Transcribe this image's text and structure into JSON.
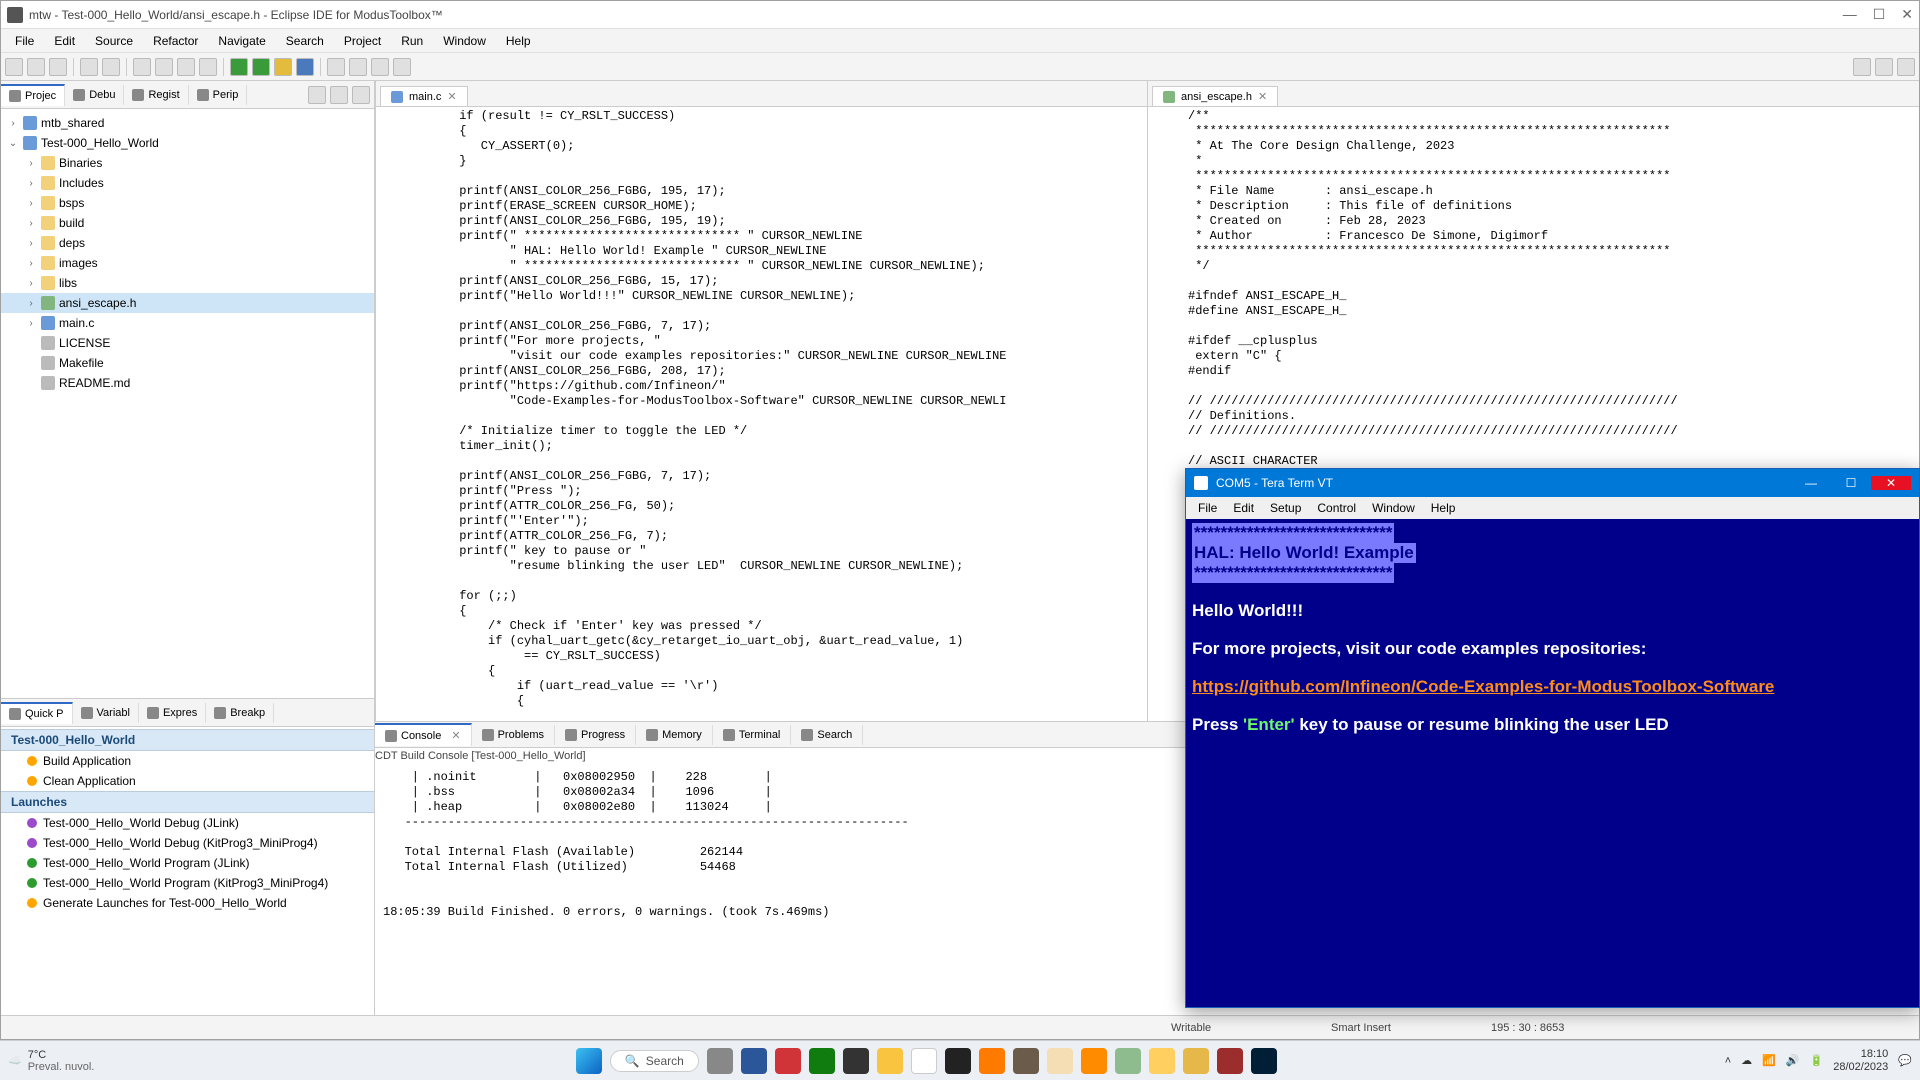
{
  "eclipse": {
    "title": "mtw - Test-000_Hello_World/ansi_escape.h - Eclipse IDE for ModusToolbox™",
    "menu": [
      "File",
      "Edit",
      "Source",
      "Refactor",
      "Navigate",
      "Search",
      "Project",
      "Run",
      "Window",
      "Help"
    ],
    "left_views": [
      "Projec",
      "Debu",
      "Regist",
      "Perip"
    ],
    "tree": {
      "root1": "mtb_shared",
      "root2": "Test-000_Hello_World",
      "children": [
        "Binaries",
        "Includes",
        "bsps",
        "build",
        "deps",
        "images",
        "libs"
      ],
      "file1": "ansi_escape.h",
      "file2": "main.c",
      "file3": "LICENSE",
      "file4": "Makefile",
      "file5": "README.md"
    },
    "quick_tabs": [
      "Quick P",
      "Variabl",
      "Expres",
      "Breakp"
    ],
    "quick": {
      "section0": "Test-000_Hello_World",
      "build": "Build Application",
      "clean": "Clean Application",
      "launches_label": "Launches",
      "l1": "Test-000_Hello_World Debug (JLink)",
      "l2": "Test-000_Hello_World Debug (KitProg3_MiniProg4)",
      "l3": "Test-000_Hello_World Program (JLink)",
      "l4": "Test-000_Hello_World Program (KitProg3_MiniProg4)",
      "l5": "Generate Launches for Test-000_Hello_World"
    },
    "editor_left": {
      "tab": "main.c",
      "code": "      if (result != CY_RSLT_SUCCESS)\n      {\n         CY_ASSERT(0);\n      }\n\n      printf(ANSI_COLOR_256_FGBG, 195, 17);\n      printf(ERASE_SCREEN CURSOR_HOME);\n      printf(ANSI_COLOR_256_FGBG, 195, 19);\n      printf(\" ****************************** \" CURSOR_NEWLINE\n             \" HAL: Hello World! Example \" CURSOR_NEWLINE\n             \" ****************************** \" CURSOR_NEWLINE CURSOR_NEWLINE);\n      printf(ANSI_COLOR_256_FGBG, 15, 17);\n      printf(\"Hello World!!!\" CURSOR_NEWLINE CURSOR_NEWLINE);\n\n      printf(ANSI_COLOR_256_FGBG, 7, 17);\n      printf(\"For more projects, \"\n             \"visit our code examples repositories:\" CURSOR_NEWLINE CURSOR_NEWLINE\n      printf(ANSI_COLOR_256_FGBG, 208, 17);\n      printf(\"https://github.com/Infineon/\"\n             \"Code-Examples-for-ModusToolbox-Software\" CURSOR_NEWLINE CURSOR_NEWLI\n\n      /* Initialize timer to toggle the LED */\n      timer_init();\n\n      printf(ANSI_COLOR_256_FGBG, 7, 17);\n      printf(\"Press \");\n      printf(ATTR_COLOR_256_FG, 50);\n      printf(\"'Enter'\");\n      printf(ATTR_COLOR_256_FG, 7);\n      printf(\" key to pause or \"\n             \"resume blinking the user LED\"  CURSOR_NEWLINE CURSOR_NEWLINE);\n\n      for (;;)\n      {\n          /* Check if 'Enter' key was pressed */\n          if (cyhal_uart_getc(&cy_retarget_io_uart_obj, &uart_read_value, 1)\n               == CY_RSLT_SUCCESS)\n          {\n              if (uart_read_value == '\\r')\n              {"
    },
    "editor_right": {
      "tab": "ansi_escape.h",
      "code": "/**\n ******************************************************************\n * At The Core Design Challenge, 2023\n *\n ******************************************************************\n * File Name       : ansi_escape.h\n * Description     : This file of definitions\n * Created on      : Feb 28, 2023\n * Author          : Francesco De Simone, Digimorf\n ******************************************************************\n */\n\n#ifndef ANSI_ESCAPE_H_\n#define ANSI_ESCAPE_H_\n\n#ifdef __cplusplus\n extern \"C\" {\n#endif\n\n// /////////////////////////////////////////////////////////////////\n// Definitions.\n// /////////////////////////////////////////////////////////////////\n\n// ASCII CHARACTER\n#define ASCII_NULL\n#define ASCII_BS\n#define ASCII_TAB\n#define ASCII_LF\n#define ASCII_CR\n#define ASCII_ESC\n#define ASCII_SPAC\n#define ASCII_A\n#define ASCII_L\n#define ASCII_Z\n#define ASCII_a\n#define ASCII_z\n#define ASCII_0\n#define ASCII_9\n#define ASCII_Q"
    },
    "bottom_tabs": [
      "Console",
      "Problems",
      "Progress",
      "Memory",
      "Terminal",
      "Search"
    ],
    "console_header": "CDT Build Console [Test-000_Hello_World]",
    "console": "    | .noinit        |   0x08002950  |    228        |\n    | .bss           |   0x08002a34  |    1096       |\n    | .heap          |   0x08002e80  |    113024     |\n   ----------------------------------------------------------------------\n\n   Total Internal Flash (Available)         262144\n   Total Internal Flash (Utilized)          54468\n\n\n18:05:39 Build Finished. 0 errors, 0 warnings. (took 7s.469ms)\n",
    "status": {
      "writable": "Writable",
      "insert": "Smart Insert",
      "pos": "195 : 30 : 8653"
    }
  },
  "teraterm": {
    "title": "COM5 - Tera Term VT",
    "menu": [
      "File",
      "Edit",
      "Setup",
      "Control",
      "Window",
      "Help"
    ],
    "banner_top": "******************************",
    "banner_mid": " HAL: Hello World! Example ",
    "banner_bot": "******************************",
    "hello": "Hello World!!!",
    "line2": "For more projects, visit our code examples repositories:",
    "link": "https://github.com/Infineon/Code-Examples-for-ModusToolbox-Software",
    "press_a": "Press ",
    "press_enter": "'Enter'",
    "press_b": " key to pause or resume blinking the user LED"
  },
  "taskbar": {
    "temp": "7°C",
    "cond": "Preval. nuvol.",
    "search": "Search",
    "time": "18:10",
    "date": "28/02/2023"
  }
}
